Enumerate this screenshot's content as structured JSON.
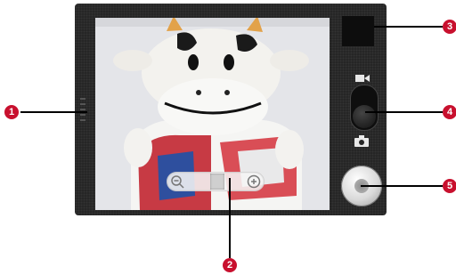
{
  "callouts": [
    "1",
    "2",
    "3",
    "4",
    "5"
  ],
  "zoom": {
    "level": 0.55
  },
  "camera_mode": "camera",
  "icons": {
    "zoom_out": "zoom-out-icon",
    "zoom_in": "zoom-in-icon",
    "video": "video-camera-icon",
    "camera": "camera-icon"
  },
  "colors": {
    "callout": "#c8102e",
    "device": "#262626"
  }
}
